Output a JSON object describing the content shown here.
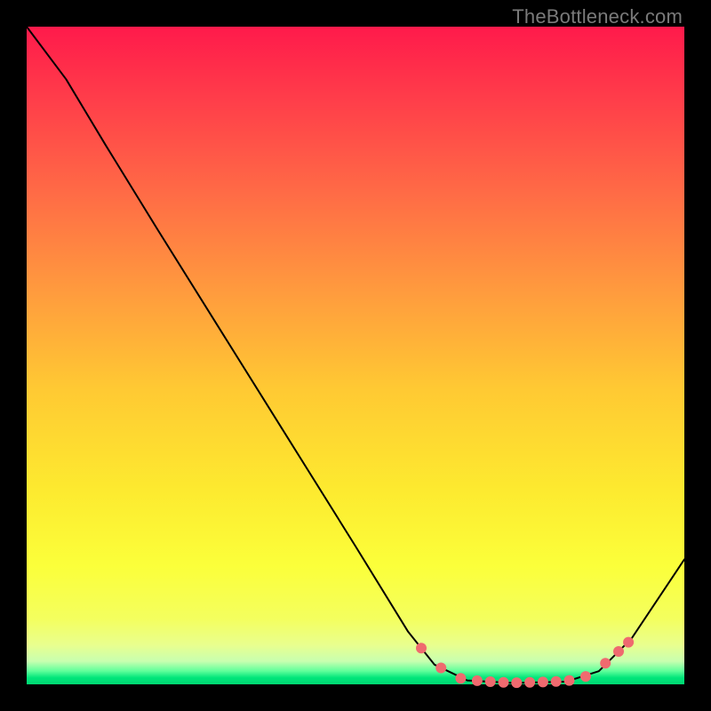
{
  "watermark": "TheBottleneck.com",
  "chart_data": {
    "type": "line",
    "title": "",
    "xlabel": "",
    "ylabel": "",
    "xlim": [
      0,
      100
    ],
    "ylim": [
      0,
      100
    ],
    "grid": false,
    "curve": {
      "name": "bottleneck-curve",
      "color": "#000000",
      "stroke_width": 2,
      "points": [
        {
          "x": 0,
          "y": 100
        },
        {
          "x": 6,
          "y": 92
        },
        {
          "x": 12,
          "y": 82
        },
        {
          "x": 20,
          "y": 69
        },
        {
          "x": 30,
          "y": 53
        },
        {
          "x": 40,
          "y": 37
        },
        {
          "x": 50,
          "y": 21
        },
        {
          "x": 58,
          "y": 8
        },
        {
          "x": 62,
          "y": 3
        },
        {
          "x": 67,
          "y": 0.6
        },
        {
          "x": 74,
          "y": 0.2
        },
        {
          "x": 82,
          "y": 0.4
        },
        {
          "x": 87,
          "y": 2
        },
        {
          "x": 92,
          "y": 7
        },
        {
          "x": 100,
          "y": 19
        }
      ]
    },
    "markers": {
      "name": "optimal-range-dots",
      "color": "#ef6a6f",
      "radius": 6,
      "points": [
        {
          "x": 60,
          "y": 5.5
        },
        {
          "x": 63,
          "y": 2.5
        },
        {
          "x": 66,
          "y": 0.9
        },
        {
          "x": 68.5,
          "y": 0.55
        },
        {
          "x": 70.5,
          "y": 0.4
        },
        {
          "x": 72.5,
          "y": 0.3
        },
        {
          "x": 74.5,
          "y": 0.25
        },
        {
          "x": 76.5,
          "y": 0.3
        },
        {
          "x": 78.5,
          "y": 0.35
        },
        {
          "x": 80.5,
          "y": 0.45
        },
        {
          "x": 82.5,
          "y": 0.6
        },
        {
          "x": 85,
          "y": 1.2
        },
        {
          "x": 88,
          "y": 3.2
        },
        {
          "x": 90,
          "y": 5.0
        },
        {
          "x": 91.5,
          "y": 6.4
        }
      ]
    }
  }
}
